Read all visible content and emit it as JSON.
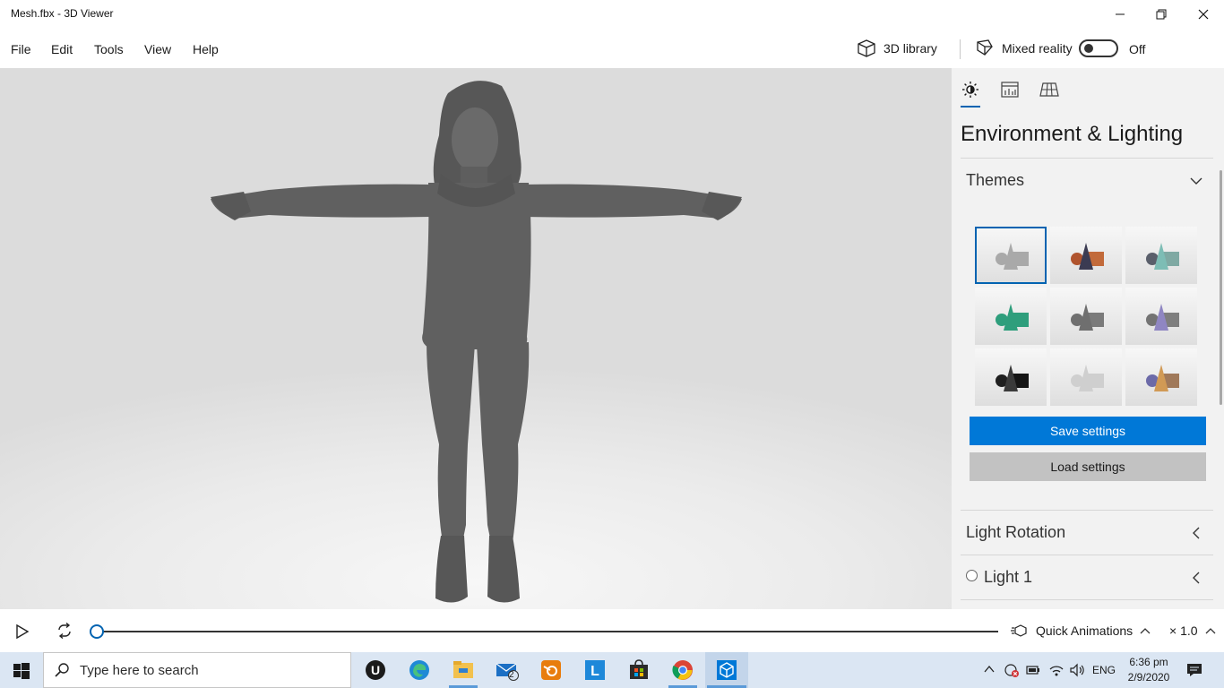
{
  "window": {
    "title": "Mesh.fbx - 3D Viewer"
  },
  "menu": {
    "items": [
      "File",
      "Edit",
      "Tools",
      "View",
      "Help"
    ]
  },
  "toolbar": {
    "library_label": "3D library",
    "mixed_reality_label": "Mixed reality",
    "toggle_state": "Off"
  },
  "panel": {
    "title": "Environment & Lighting",
    "tabs": [
      "lighting-icon",
      "stats-icon",
      "grid-icon"
    ],
    "themes_label": "Themes",
    "themes": [
      {
        "cone": "#a9a9a9",
        "sphere": "#a9a9a9",
        "box": "#a9a9a9"
      },
      {
        "cone": "#3b3b52",
        "sphere": "#b0542e",
        "box": "#c26a3a"
      },
      {
        "cone": "#7dbdb5",
        "sphere": "#5a5f6b",
        "box": "#7fa9a3"
      },
      {
        "cone": "#2e9e7c",
        "sphere": "#2e9e7c",
        "box": "#2e9e7c"
      },
      {
        "cone": "#6f6f6f",
        "sphere": "#6f6f6f",
        "box": "#7a7a7a"
      },
      {
        "cone": "#8f86c2",
        "sphere": "#737373",
        "box": "#7e7e7e"
      },
      {
        "cone": "#3a3a3a",
        "sphere": "#1f1f1f",
        "box": "#151515"
      },
      {
        "cone": "#cfcfcf",
        "sphere": "#cfcfcf",
        "box": "#cfcfcf"
      },
      {
        "cone": "#d19a55",
        "sphere": "#6c6aa8",
        "box": "#a0795a"
      }
    ],
    "save_label": "Save settings",
    "load_label": "Load settings",
    "light_rotation_label": "Light Rotation",
    "light1_label": "Light 1"
  },
  "timeline": {
    "quick_animations_label": "Quick Animations",
    "speed_label": "× 1.0",
    "progress": 0
  },
  "taskbar": {
    "search_placeholder": "Type here to search",
    "mail_badge": "2",
    "lang": "ENG",
    "time": "6:36 pm",
    "date": "2/9/2020"
  },
  "colors": {
    "accent": "#0078d7",
    "model": "#606060"
  }
}
